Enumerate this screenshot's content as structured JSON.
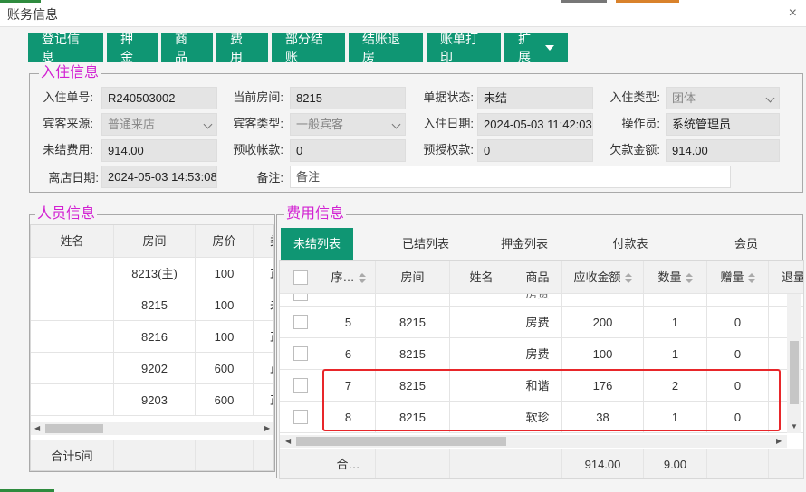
{
  "window": {
    "title": "账务信息",
    "close_glyph": "×"
  },
  "toolbar": [
    "登记信息",
    "押金",
    "商品",
    "费用",
    "部分结账",
    "结账退房",
    "账单打印",
    "扩展"
  ],
  "checkin": {
    "legend": "入住信息",
    "fields": [
      {
        "label": "入住单号:",
        "value": "R240503002",
        "kind": "text"
      },
      {
        "label": "当前房间:",
        "value": "8215",
        "kind": "text"
      },
      {
        "label": "单据状态:",
        "value": "未结",
        "kind": "text"
      },
      {
        "label": "入住类型:",
        "value": "团体",
        "kind": "select"
      },
      {
        "label": "宾客来源:",
        "value": "普通来店",
        "kind": "select"
      },
      {
        "label": "宾客类型:",
        "value": "一般宾客",
        "kind": "select"
      },
      {
        "label": "入住日期:",
        "value": "2024-05-03 11:42:03",
        "kind": "text"
      },
      {
        "label": "操作员:",
        "value": "系统管理员",
        "kind": "text"
      },
      {
        "label": "未结费用:",
        "value": "914.00",
        "kind": "text"
      },
      {
        "label": "预收帐款:",
        "value": "0",
        "kind": "text"
      },
      {
        "label": "预授权款:",
        "value": "0",
        "kind": "text"
      },
      {
        "label": "欠款金额:",
        "value": "914.00",
        "kind": "text"
      },
      {
        "label": "离店日期:",
        "value": "2024-05-03 14:53:08",
        "kind": "text"
      }
    ],
    "remark_label": "备注:",
    "remark_placeholder": "备注"
  },
  "people": {
    "legend": "人员信息",
    "headers": [
      "姓名",
      "房间",
      "房价",
      "类"
    ],
    "rows": [
      {
        "name": "",
        "room": "8213(主)",
        "price": "100",
        "type": "正"
      },
      {
        "name": "",
        "room": "8215",
        "price": "100",
        "type": "未"
      },
      {
        "name": "",
        "room": "8216",
        "price": "100",
        "type": "正"
      },
      {
        "name": "",
        "room": "9202",
        "price": "600",
        "type": "正"
      },
      {
        "name": "",
        "room": "9203",
        "price": "600",
        "type": "正"
      }
    ],
    "footer": "合计5间"
  },
  "fees": {
    "legend": "费用信息",
    "tabs": [
      "未结列表",
      "已结列表",
      "押金列表",
      "付款表",
      "会员"
    ],
    "headers": [
      "序…",
      "房间",
      "姓名",
      "商品",
      "应收金额",
      "数量",
      "赠量",
      "退量"
    ],
    "partial_row": {
      "item": "房费"
    },
    "rows": [
      {
        "seq": "5",
        "room": "8215",
        "name": "",
        "item": "房费",
        "amount": "200",
        "qty": "1",
        "gift": "0"
      },
      {
        "seq": "6",
        "room": "8215",
        "name": "",
        "item": "房费",
        "amount": "100",
        "qty": "1",
        "gift": "0"
      },
      {
        "seq": "7",
        "room": "8215",
        "name": "",
        "item": "和谐",
        "amount": "176",
        "qty": "2",
        "gift": "0"
      },
      {
        "seq": "8",
        "room": "8215",
        "name": "",
        "item": "软珍",
        "amount": "38",
        "qty": "1",
        "gift": "0"
      }
    ],
    "footer": {
      "seq": "合…",
      "amount": "914.00",
      "qty": "9.00"
    }
  },
  "colors": {
    "accent": "#0f9673",
    "legend": "#d222d2",
    "highlight": "#e8262a"
  }
}
